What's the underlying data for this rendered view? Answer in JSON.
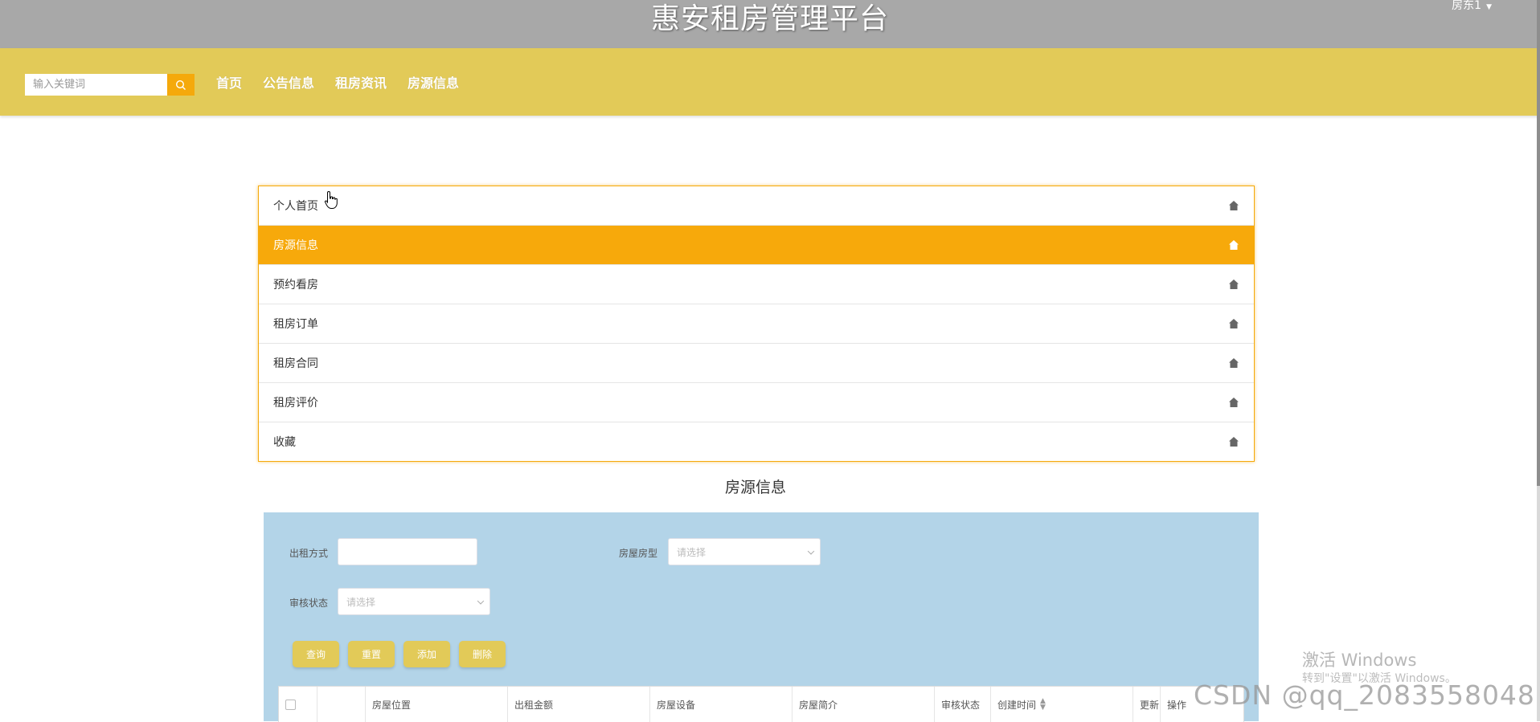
{
  "header": {
    "title": "惠安租房管理平台",
    "user_label": "房东1",
    "background_color": "#a8a8a8"
  },
  "navbar": {
    "search_placeholder": "输入关键词",
    "links": [
      "首页",
      "公告信息",
      "租房资讯",
      "房源信息"
    ],
    "background_color": "#e2ca58",
    "accent_color": "#f5a90b"
  },
  "side_menu": {
    "items": [
      {
        "label": "个人首页",
        "active": false
      },
      {
        "label": "房源信息",
        "active": true
      },
      {
        "label": "预约看房",
        "active": false
      },
      {
        "label": "租房订单",
        "active": false
      },
      {
        "label": "租房合同",
        "active": false
      },
      {
        "label": "租房评价",
        "active": false
      },
      {
        "label": "收藏",
        "active": false
      }
    ],
    "item_icon": "home-icon",
    "active_color": "#f7a90b"
  },
  "section": {
    "title": "房源信息"
  },
  "filters": {
    "rent_mode_label": "出租方式",
    "rent_mode_value": "",
    "house_type_label": "房屋房型",
    "house_type_placeholder": "请选择",
    "audit_status_label": "审核状态",
    "audit_status_placeholder": "请选择",
    "panel_color": "#b3d4e8"
  },
  "buttons": {
    "query": "查询",
    "reset": "重置",
    "add": "添加",
    "delete": "删除"
  },
  "table": {
    "columns": [
      "",
      "",
      "房屋位置",
      "出租金额",
      "房屋设备",
      "房屋简介",
      "审核状态",
      "创建时间",
      "更新",
      "操作"
    ]
  },
  "watermarks": {
    "activate_title": "激活 Windows",
    "activate_sub": "转到\"设置\"以激活 Windows。",
    "csdn": "CSDN @qq_2083558048"
  }
}
